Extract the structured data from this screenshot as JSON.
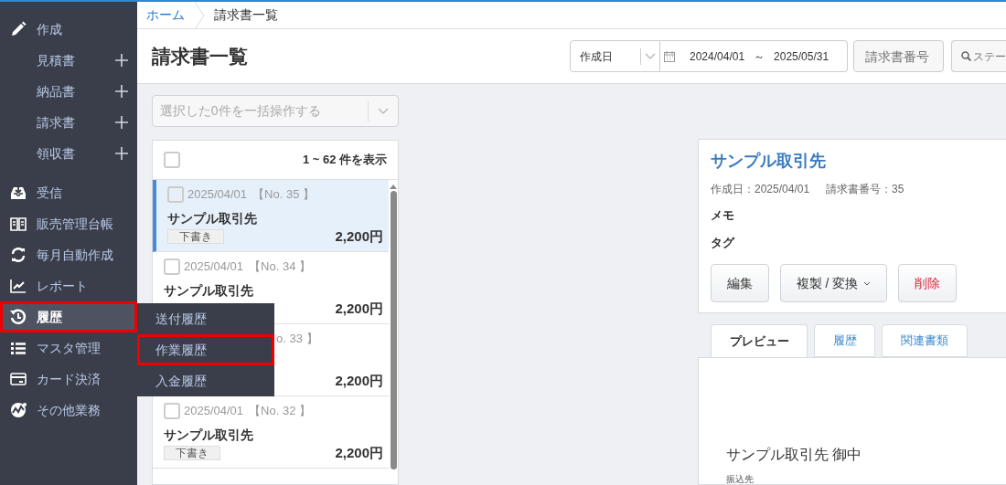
{
  "breadcrumb": [
    {
      "label": "ホーム",
      "kind": "link"
    },
    {
      "label": "請求書一覧",
      "kind": "current"
    }
  ],
  "sidebar": {
    "items": [
      {
        "label": "作成",
        "selected": false,
        "annotated": false,
        "children": [
          {
            "label": "見積書"
          },
          {
            "label": "納品書"
          },
          {
            "label": "請求書"
          },
          {
            "label": "領収書"
          }
        ]
      },
      {
        "label": "受信",
        "selected": false,
        "annotated": false
      },
      {
        "label": "販売管理台帳",
        "selected": false,
        "annotated": false
      },
      {
        "label": "毎月自動作成",
        "selected": false,
        "annotated": false
      },
      {
        "label": "レポート",
        "selected": false,
        "annotated": false
      },
      {
        "label": "履歴",
        "selected": true,
        "annotated": true
      },
      {
        "label": "マスタ管理",
        "selected": false,
        "annotated": false
      },
      {
        "label": "カード決済",
        "selected": false,
        "annotated": false
      },
      {
        "label": "その他業務",
        "selected": false,
        "annotated": false
      }
    ]
  },
  "submenu": [
    {
      "label": "送付履歴",
      "annotated": false
    },
    {
      "label": "作業履歴",
      "annotated": true
    },
    {
      "label": "入金履歴",
      "annotated": false
    }
  ],
  "page_title": "請求書一覧",
  "filters": {
    "date_type": "作成日",
    "date_from": "2024/04/01",
    "date_separator": "～",
    "date_to": "2025/05/31",
    "number_placeholder": "請求書番号",
    "search_placeholder": "ステー"
  },
  "bulk_action": {
    "placeholder": "選択した0件を一括操作する"
  },
  "list": {
    "count": "1 ~ 62 件を表示",
    "all_checked": false,
    "items": [
      {
        "kind": "full",
        "date": "2025/04/01",
        "number": "【No. 35 】",
        "name": "サンプル取引先",
        "badge": "下書き",
        "amount": "2,200円",
        "selected": true,
        "checked": false
      },
      {
        "kind": "full",
        "date": "2025/04/01",
        "number": "【No. 34 】",
        "name": "サンプル取引先",
        "amount": "2,200円",
        "selected": false,
        "checked": false
      },
      {
        "kind": "covered",
        "number": "o. 33 】",
        "amount": "2,200円",
        "selected": false
      },
      {
        "kind": "full",
        "date": "2025/04/01",
        "number": "【No. 32 】",
        "name": "サンプル取引先",
        "badge": "下書き",
        "amount": "2,200円",
        "selected": false,
        "checked": false
      }
    ]
  },
  "detail": {
    "title": "サンプル取引先",
    "meta": [
      {
        "label": "作成日：2025/04/01"
      },
      {
        "label": "請求書番号：35"
      }
    ],
    "fields": [
      "メモ",
      "タグ"
    ],
    "buttons": [
      {
        "label": "編集",
        "kind": "normal"
      },
      {
        "label": "複製 / 変換",
        "kind": "dropdown"
      },
      {
        "label": "削除",
        "kind": "danger"
      }
    ]
  },
  "tabs": [
    {
      "label": "プレビュー",
      "selected": true
    },
    {
      "label": "履歴",
      "selected": false
    },
    {
      "label": "関連書類",
      "selected": false
    }
  ],
  "preview": {
    "addressee": "サンプル取引先 御中",
    "section": "振込先"
  }
}
